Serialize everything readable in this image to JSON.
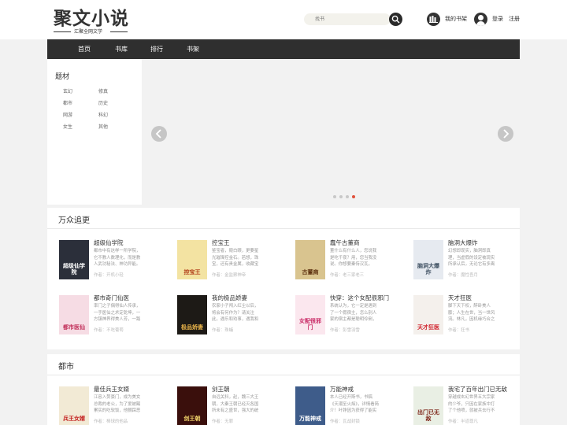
{
  "header": {
    "logo_title": "聚文小说",
    "logo_sub": "汇聚全网文学",
    "search_placeholder": "找书",
    "shelf_label": "我的书架",
    "login_label": "登录",
    "register_label": "注册"
  },
  "nav": [
    "首页",
    "书库",
    "排行",
    "书架"
  ],
  "genre": {
    "title": "题材",
    "items": [
      "玄幻",
      "修真",
      "都市",
      "历史",
      "网游",
      "科幻",
      "女生",
      "其他"
    ]
  },
  "banner": {
    "dots": 4,
    "active_dot": 4
  },
  "sections": [
    {
      "title": "万众追更",
      "books": [
        {
          "title": "超级仙学院",
          "desc": "都市中有这样一所学院，它不教人数理化，而是教人武功秘法、神功异能。学院的",
          "author": "作者：开机小轻",
          "cover_text": "超级仙学院",
          "cover_bg": "#2b2f3a",
          "cover_fg": "#ffffff"
        },
        {
          "title": "控宝王",
          "desc": "鉴宝者，窥白眼，更要星光璀璨控金石。若想，珠宝，还有贵金属，收藏宝的世界",
          "author": "作者：金监察神帝",
          "cover_text": "控宝王",
          "cover_bg": "#f3e3a2",
          "cover_fg": "#b03a16"
        },
        {
          "title": "蠢午古董商",
          "desc": "董什么有什么人，您说我是吃千夜？用，您当我没说。你想要秦侍汉瓦，成，一手车",
          "author": "作者：老三家老三",
          "cover_text": "古董商",
          "cover_bg": "#d9c48f",
          "cover_fg": "#5a2d0c"
        },
        {
          "title": "脑洞大爆炸",
          "desc": "幻想即现实，脑洞即真理，当虚假的设定被现实所承认后，无论它有多离谱，那也",
          "author": "作者：魔性吾月",
          "cover_text": "脑洞大爆炸",
          "cover_bg": "#e6eaf0",
          "cover_fg": "#445566"
        },
        {
          "title": "都市奇门仙医",
          "desc": "率门之子偶得仙人传承，一手医仙之术定乾坤，一方镇神界得美人芳，一路风光精",
          "author": "作者：不吃葡萄",
          "cover_text": "都市医仙",
          "cover_bg": "#f6dce4",
          "cover_fg": "#c2305a"
        },
        {
          "title": "我的极品娇妻",
          "desc": "农家小子闯入红尘以后，将会有何作为？请关注此，遇乐和劝事，遇我和逍，遇土后",
          "author": "作者：珠蛹",
          "cover_text": "极品娇妻",
          "cover_bg": "#1d1a16",
          "cover_fg": "#e8b34a"
        },
        {
          "title": "快穿：这个女配很邪门",
          "desc": "系统认为，它一定是遇到了一个假宿主，怎么别人家的宿主都是聪明伶俐，冷静理",
          "author": "作者：彭雪羽雪",
          "cover_text": "女配很邪门",
          "cover_bg": "#fbe7ee",
          "cover_fg": "#c92a66"
        },
        {
          "title": "天才狂医",
          "desc": "脚下天下权，醉卧美人膝；人生在世，当一世风流。林凡，因机缘巧合之下获得了",
          "author": "作者：狂书",
          "cover_text": "天才狂医",
          "cover_bg": "#f4f0ec",
          "cover_fg": "#d0202a"
        }
      ]
    },
    {
      "title": "都市",
      "books": [
        {
          "title": "最佳兵王女婿",
          "desc": "江容入赘豪门，成为美女总裁的老公，为了爱被踢累实的吃软饭，他颤踩恶少，",
          "author": "作者：棒球的他品",
          "cover_text": "兵王女婿",
          "cover_bg": "#f2ead5",
          "cover_fg": "#c21818"
        },
        {
          "title": "剑王朝",
          "desc": "自远关科，赵，魏三大王朝，大秦王朝已经灭各国所未有之盛世，强大的统行者",
          "author": "作者：无罪",
          "cover_text": "剑王朝",
          "cover_bg": "#3a0f0c",
          "cover_fg": "#f1d36a"
        },
        {
          "title": "万能神戒",
          "desc": "本人已经开斯书，书稿《天潮至火焰》，详情看简介！叶铮因为获得了能实生活的",
          "author": "作者：瓦战封锁",
          "cover_text": "万能神戒",
          "cover_bg": "#3e5c8a",
          "cover_fg": "#ffffff"
        },
        {
          "title": "我宅了百年出门已无敌",
          "desc": "穿越成玄幻世界五大宗家的少爷，只因在家族中打了个他喷，就被兵去行不满，百",
          "author": "作者：半道尊凡",
          "cover_text": "出门已无敌",
          "cover_bg": "#e9efe4",
          "cover_fg": "#7a1f12"
        }
      ]
    }
  ]
}
